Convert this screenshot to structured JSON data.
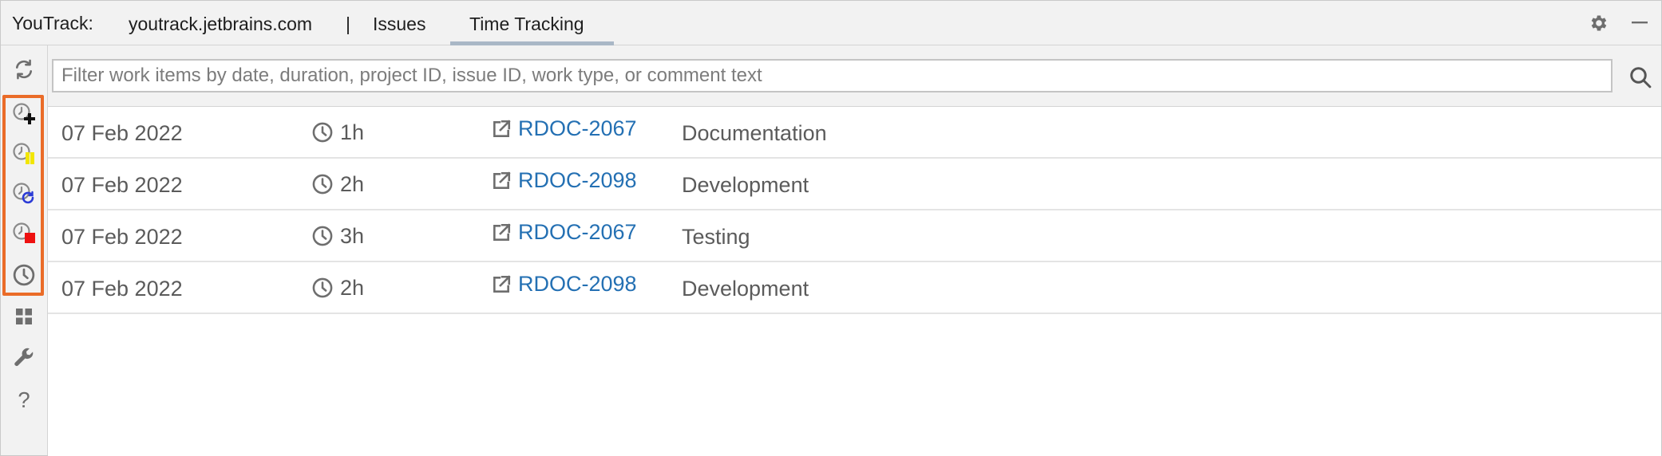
{
  "header": {
    "title": "YouTrack:",
    "tabs": {
      "server": "youtrack.jetbrains.com",
      "separator": "|",
      "issues": "Issues",
      "time_tracking": "Time Tracking"
    },
    "active_tab": "time_tracking",
    "icons": [
      "gear-icon",
      "minimize-icon"
    ]
  },
  "toolbar": {
    "icons": [
      "refresh-icon",
      "timer-add-icon",
      "timer-pause-icon",
      "timer-reset-icon",
      "timer-stop-icon",
      "clock-icon",
      "grid-icon",
      "wrench-icon",
      "help-icon"
    ],
    "highlight_color": "#ea6c28"
  },
  "filter": {
    "placeholder": "Filter work items by date, duration, project ID, issue ID, work type, or comment text",
    "value": ""
  },
  "work_items": [
    {
      "date": "07 Feb 2022",
      "duration": "1h",
      "issue": "RDOC-2067",
      "type": "Documentation"
    },
    {
      "date": "07 Feb 2022",
      "duration": "2h",
      "issue": "RDOC-2098",
      "type": "Development"
    },
    {
      "date": "07 Feb 2022",
      "duration": "3h",
      "issue": "RDOC-2067",
      "type": "Testing"
    },
    {
      "date": "07 Feb 2022",
      "duration": "2h",
      "issue": "RDOC-2098",
      "type": "Development"
    }
  ],
  "colors": {
    "link": "#2470b3",
    "text": "#5b5b5b",
    "active_tab_underline": "#a9b7c6"
  }
}
